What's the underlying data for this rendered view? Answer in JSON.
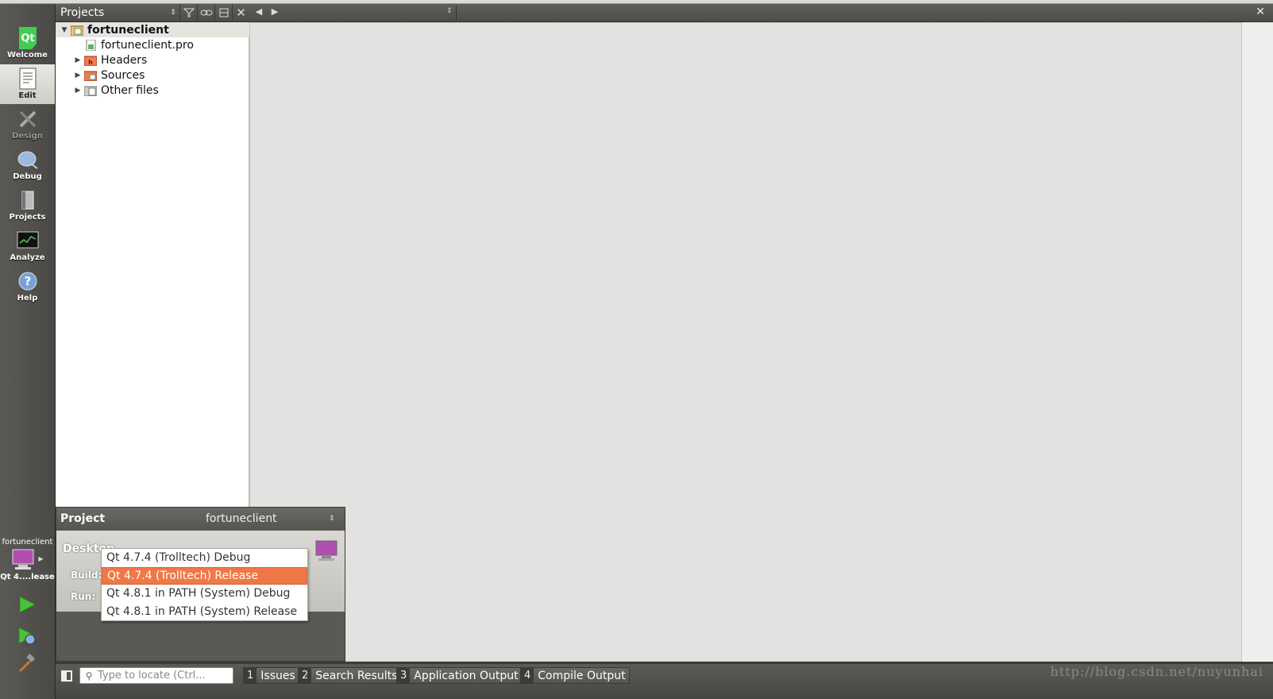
{
  "modes": [
    {
      "label": "Welcome",
      "icon": "qt-logo-icon",
      "active": false,
      "disabled": false
    },
    {
      "label": "Edit",
      "icon": "edit-document-icon",
      "active": true,
      "disabled": false
    },
    {
      "label": "Design",
      "icon": "design-tools-icon",
      "active": false,
      "disabled": true
    },
    {
      "label": "Debug",
      "icon": "debug-bug-icon",
      "active": false,
      "disabled": false
    },
    {
      "label": "Projects",
      "icon": "projects-book-icon",
      "active": false,
      "disabled": false
    },
    {
      "label": "Analyze",
      "icon": "analyze-monitor-icon",
      "active": false,
      "disabled": false
    },
    {
      "label": "Help",
      "icon": "help-question-icon",
      "active": false,
      "disabled": false
    }
  ],
  "target": {
    "project": "fortuneclient",
    "kit": "Qt 4....lease"
  },
  "projects_pane": {
    "title": "Projects",
    "tree": [
      {
        "label": "fortuneclient",
        "bold": true,
        "expanded": true
      },
      {
        "label": "fortuneclient.pro"
      },
      {
        "label": "Headers"
      },
      {
        "label": "Sources"
      },
      {
        "label": "Other files"
      }
    ]
  },
  "popup": {
    "project_label": "Project",
    "project_value": "fortuneclient",
    "target_name": "Desktop",
    "build_label": "Build:",
    "run_label": "Run:",
    "build_options": [
      {
        "label": "Qt 4.7.4 (Trolltech) Debug",
        "selected": false
      },
      {
        "label": "Qt 4.7.4 (Trolltech) Release",
        "selected": true
      },
      {
        "label": "Qt 4.8.1 in PATH (System) Debug",
        "selected": false
      },
      {
        "label": "Qt 4.8.1 in PATH (System) Release",
        "selected": false
      }
    ]
  },
  "output": {
    "locator_placeholder": "Type to locate (Ctrl...",
    "tabs": [
      {
        "num": "1",
        "label": "Issues"
      },
      {
        "num": "2",
        "label": "Search Results"
      },
      {
        "num": "3",
        "label": "Application Output"
      },
      {
        "num": "4",
        "label": "Compile Output"
      }
    ]
  },
  "watermark": "http://blog.csdn.net/nuyunhai",
  "colors": {
    "accent": "#f07746",
    "sidebar": "#4a4945",
    "editor_bg": "#e3e2e0"
  }
}
